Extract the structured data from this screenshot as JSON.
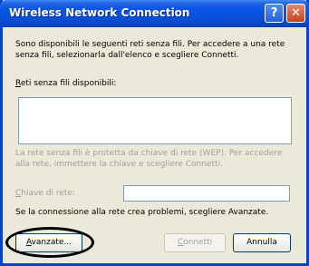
{
  "window": {
    "title": "Wireless Network Connection",
    "help_glyph": "?",
    "close_glyph": "✕"
  },
  "intro": {
    "line1": "Sono disponibili le seguenti reti senza fili. Per accedere a una rete",
    "line2": "senza fili, selezionarla dall'elenco e scegliere Connetti."
  },
  "networks": {
    "label_accel": "R",
    "label_rest": "eti senza fili disponibili:",
    "items": []
  },
  "wep": {
    "line1": "La rete senza fili è protetta da chiave di rete (WEP). Per accedere",
    "line2": "alla rete, immettere la chiave e scegliere Connetti.",
    "key_label_accel": "C",
    "key_label_rest": "hiave di rete:",
    "key_value": ""
  },
  "hint": "Se la connessione alla rete crea problemi, scegliere Avanzate.",
  "buttons": {
    "advanced_accel": "A",
    "advanced_rest": "vanzate...",
    "connect_accel": "C",
    "connect_rest": "onnetti",
    "cancel": "Annulla"
  }
}
